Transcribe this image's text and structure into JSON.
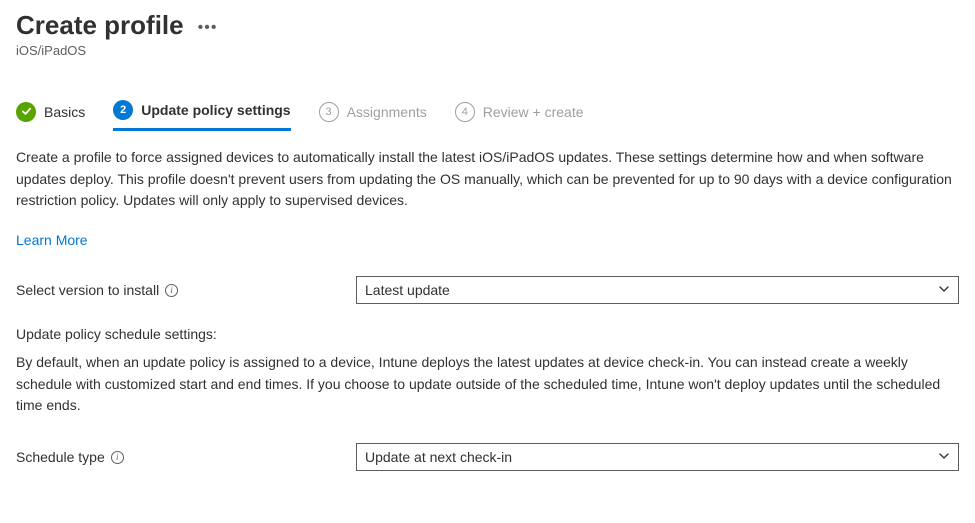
{
  "header": {
    "title": "Create profile",
    "subtitle": "iOS/iPadOS"
  },
  "tabs": {
    "basics": {
      "label": "Basics"
    },
    "update_policy": {
      "number": "2",
      "label": "Update policy settings"
    },
    "assignments": {
      "number": "3",
      "label": "Assignments"
    },
    "review": {
      "number": "4",
      "label": "Review + create"
    }
  },
  "body": {
    "description": "Create a profile to force assigned devices to automatically install the latest iOS/iPadOS updates. These settings determine how and when software updates deploy. This profile doesn't prevent users from updating the OS manually, which can be prevented for up to 90 days with a device configuration restriction policy. Updates will only apply to supervised devices.",
    "learn_more": "Learn More"
  },
  "fields": {
    "select_version": {
      "label": "Select version to install",
      "value": "Latest update"
    },
    "schedule_heading": "Update policy schedule settings:",
    "schedule_description": "By default, when an update policy is assigned to a device, Intune deploys the latest updates at device check-in. You can instead create a weekly schedule with customized start and end times. If you choose to update outside of the scheduled time, Intune won't deploy updates until the scheduled time ends.",
    "schedule_type": {
      "label": "Schedule type",
      "value": "Update at next check-in"
    }
  }
}
